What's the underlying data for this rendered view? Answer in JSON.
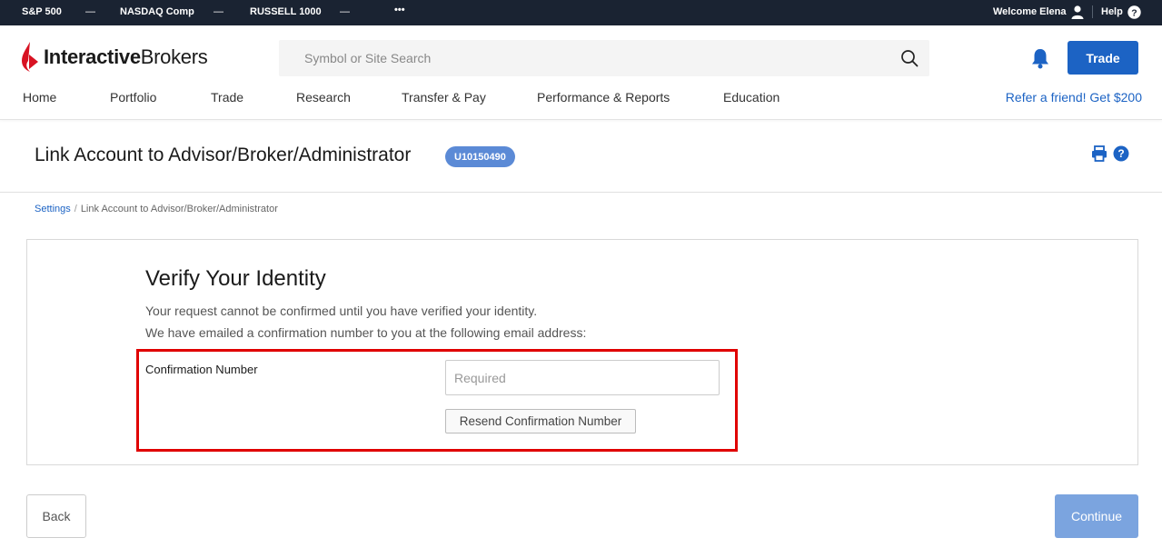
{
  "ticker": {
    "items": [
      {
        "name": "S&P 500",
        "value": "—"
      },
      {
        "name": "NASDAQ Comp",
        "value": "—"
      },
      {
        "name": "RUSSELL 1000",
        "value": "—"
      }
    ],
    "more": "•••",
    "welcome": "Welcome Elena",
    "help": "Help"
  },
  "header": {
    "logo_part1": "Interactive",
    "logo_part2": "Brokers",
    "search_placeholder": "Symbol or Site Search",
    "trade_label": "Trade",
    "nav": [
      "Home",
      "Portfolio",
      "Trade",
      "Research",
      "Transfer & Pay",
      "Performance & Reports",
      "Education"
    ],
    "refer": "Refer a friend! Get $200",
    "brand_color": "#1c63c4",
    "logo_red": "#d81222"
  },
  "page": {
    "title": "Link Account to Advisor/Broker/Administrator",
    "account_badge": "U10150490"
  },
  "breadcrumb": {
    "root": "Settings",
    "separator": "/",
    "current": "Link Account to Advisor/Broker/Administrator"
  },
  "verify": {
    "title": "Verify Your Identity",
    "line1": "Your request cannot be confirmed until you have verified your identity.",
    "line2": "We have emailed a confirmation number to you at the following email address:",
    "conf_label": "Confirmation Number",
    "conf_value": "",
    "conf_placeholder": "Required",
    "resend_label": "Resend Confirmation Number"
  },
  "footer": {
    "back_label": "Back",
    "continue_label": "Continue"
  }
}
